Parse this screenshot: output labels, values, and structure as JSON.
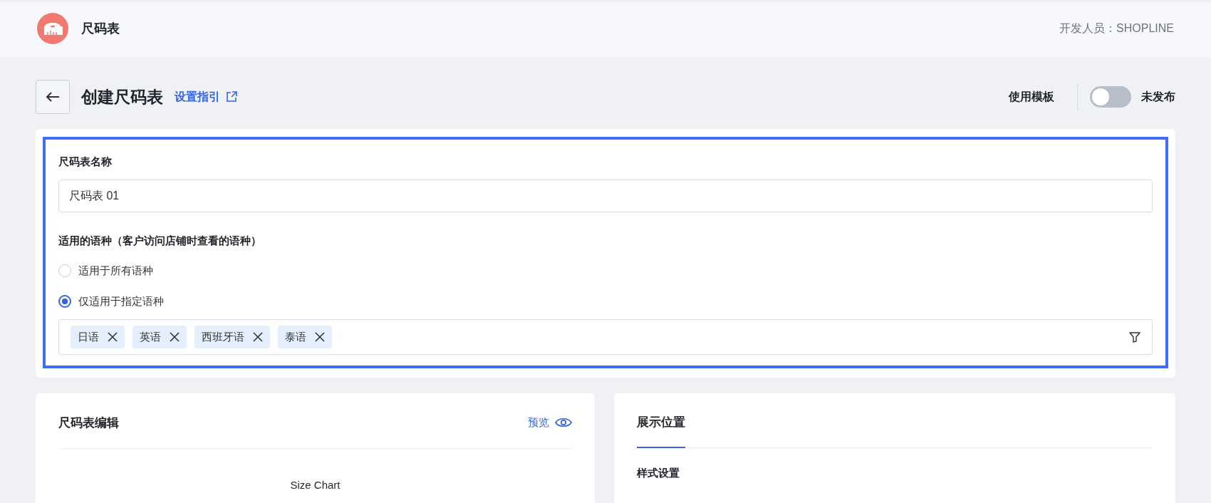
{
  "header": {
    "app_name": "尺码表",
    "developer": "开发人员：SHOPLINE"
  },
  "page": {
    "title": "创建尺码表",
    "guide_link": "设置指引",
    "template_button": "使用模板",
    "publish_toggle": {
      "on": false
    },
    "publish_status": "未发布"
  },
  "form": {
    "highlighted": true,
    "name_label": "尺码表名称",
    "name_value": "尺码表 01",
    "language_label": "适用的语种（客户访问店铺时查看的语种）",
    "language_options": [
      {
        "label": "适用于所有语种",
        "selected": false
      },
      {
        "label": "仅适用于指定语种",
        "selected": true
      }
    ],
    "languages": [
      "日语",
      "英语",
      "西班牙语",
      "泰语"
    ]
  },
  "editor": {
    "title": "尺码表编辑",
    "preview_link": "预览",
    "chart_title": "Size Chart"
  },
  "display": {
    "tabs": [
      {
        "label": "展示位置",
        "selected": true
      }
    ],
    "section_title": "样式设置"
  }
}
